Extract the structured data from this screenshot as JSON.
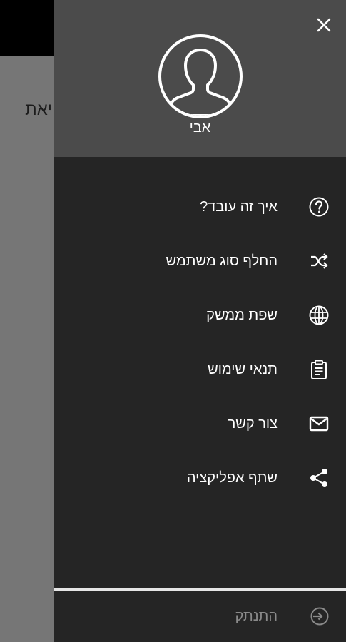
{
  "background": {
    "visible_text": "יאת"
  },
  "drawer": {
    "user_name": "אבי",
    "menu_items": [
      {
        "label": "איך זה עובד?",
        "icon": "help-circle-icon"
      },
      {
        "label": "החלף סוג משתמש",
        "icon": "shuffle-icon"
      },
      {
        "label": "שפת ממשק",
        "icon": "globe-icon"
      },
      {
        "label": "תנאי שימוש",
        "icon": "clipboard-icon"
      },
      {
        "label": "צור קשר",
        "icon": "mail-icon"
      },
      {
        "label": "שתף אפליקציה",
        "icon": "share-icon"
      }
    ],
    "logout_label": "התנתק",
    "colors": {
      "header_bg": "#4b4b4b",
      "drawer_bg": "#252525",
      "logout_text": "#8a8a8a"
    }
  }
}
